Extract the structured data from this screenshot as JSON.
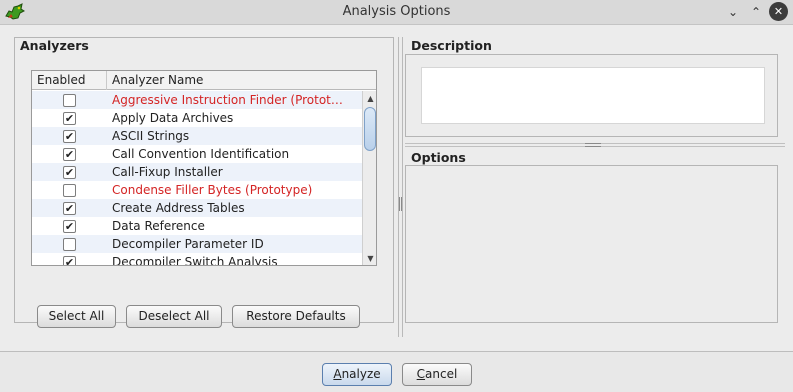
{
  "window": {
    "title": "Analysis Options",
    "controls": {
      "minimize": "⌄",
      "maximize": "⌃",
      "close": "✕"
    }
  },
  "analyzers": {
    "section_title": "Analyzers",
    "columns": {
      "enabled": "Enabled",
      "name": "Analyzer Name"
    },
    "rows": [
      {
        "enabled": false,
        "name": "Aggressive Instruction Finder (Protot…",
        "prototype": true
      },
      {
        "enabled": true,
        "name": "Apply Data Archives",
        "prototype": false
      },
      {
        "enabled": true,
        "name": "ASCII Strings",
        "prototype": false
      },
      {
        "enabled": true,
        "name": "Call Convention Identification",
        "prototype": false
      },
      {
        "enabled": true,
        "name": "Call-Fixup Installer",
        "prototype": false
      },
      {
        "enabled": false,
        "name": "Condense Filler Bytes (Prototype)",
        "prototype": true
      },
      {
        "enabled": true,
        "name": "Create Address Tables",
        "prototype": false
      },
      {
        "enabled": true,
        "name": "Data Reference",
        "prototype": false
      },
      {
        "enabled": false,
        "name": "Decompiler Parameter ID",
        "prototype": false
      },
      {
        "enabled": true,
        "name": "Decompiler Switch Analysis",
        "prototype": false
      }
    ],
    "buttons": {
      "select_all": "Select All",
      "deselect_all": "Deselect All",
      "restore_defaults": "Restore Defaults"
    }
  },
  "description": {
    "section_title": "Description",
    "text": ""
  },
  "options": {
    "section_title": "Options"
  },
  "footer": {
    "analyze_mnemonic": "A",
    "analyze_rest": "nalyze",
    "cancel_mnemonic": "C",
    "cancel_rest": "ancel"
  },
  "colors": {
    "prototype_text": "#d42424",
    "row_alt": "#edf2fa",
    "default_button_border": "#5b7fae"
  },
  "icons": {
    "app": "dragon-logo-icon",
    "checkbox_checked": "check-icon",
    "scroll_up": "triangle-up-icon",
    "scroll_down": "triangle-down-icon"
  }
}
